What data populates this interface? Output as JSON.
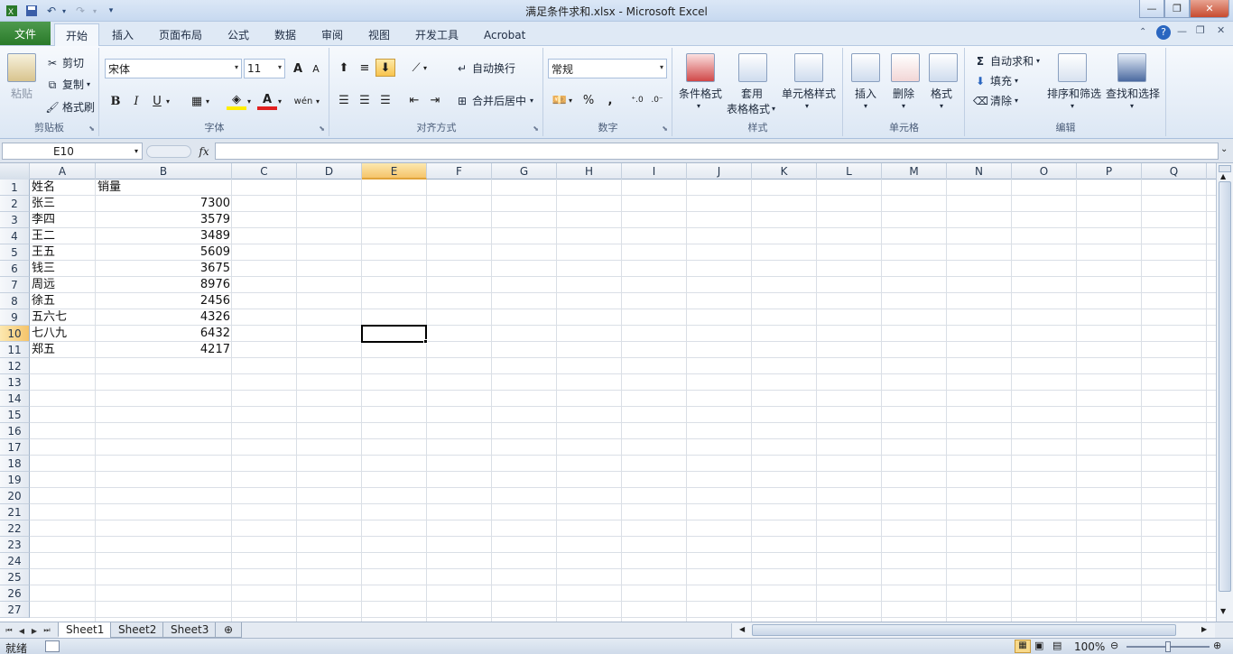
{
  "window": {
    "title": "满足条件求和.xlsx - Microsoft Excel"
  },
  "quick_access": [
    "save-icon",
    "undo-icon",
    "redo-icon",
    "customize-icon"
  ],
  "tabs": [
    {
      "label": "文件"
    },
    {
      "label": "开始"
    },
    {
      "label": "插入"
    },
    {
      "label": "页面布局"
    },
    {
      "label": "公式"
    },
    {
      "label": "数据"
    },
    {
      "label": "审阅"
    },
    {
      "label": "视图"
    },
    {
      "label": "开发工具"
    },
    {
      "label": "Acrobat"
    }
  ],
  "ribbon": {
    "clipboard": {
      "label": "剪贴板",
      "paste": "粘贴",
      "cut": "剪切",
      "copy": "复制",
      "format_painter": "格式刷"
    },
    "font": {
      "label": "字体",
      "font_name": "宋体",
      "font_size": "11",
      "bold": "B",
      "italic": "I",
      "underline": "U",
      "grow": "A",
      "shrink": "A",
      "font_color": "A",
      "phonetic": "wén"
    },
    "alignment": {
      "label": "对齐方式",
      "wrap_text": "自动换行",
      "merge_center": "合并后居中"
    },
    "number": {
      "label": "数字",
      "format": "常规",
      "percent": "%",
      "comma": ","
    },
    "styles": {
      "label": "样式",
      "conditional": "条件格式",
      "table_format_1": "套用",
      "table_format_2": "表格格式",
      "cell_styles": "单元格样式"
    },
    "cells": {
      "label": "单元格",
      "insert": "插入",
      "delete": "删除",
      "format": "格式"
    },
    "editing": {
      "label": "编辑",
      "autosum": "自动求和",
      "fill": "填充",
      "clear": "清除",
      "sort_filter": "排序和筛选",
      "find_select": "查找和选择"
    }
  },
  "formula_bar": {
    "name_box": "E10",
    "fx": "fx",
    "content": ""
  },
  "columns": [
    "A",
    "B",
    "C",
    "D",
    "E",
    "F",
    "G",
    "H",
    "I",
    "J",
    "K",
    "L",
    "M",
    "N",
    "O",
    "P",
    "Q"
  ],
  "rows": [
    "1",
    "2",
    "3",
    "4",
    "5",
    "6",
    "7",
    "8",
    "9",
    "10",
    "11",
    "12",
    "13",
    "14",
    "15",
    "16",
    "17",
    "18",
    "19",
    "20",
    "21",
    "22",
    "23",
    "24",
    "25",
    "26",
    "27"
  ],
  "sheet": {
    "header": {
      "a": "姓名",
      "b": "销量"
    },
    "data": [
      {
        "name": "张三",
        "sales": "7300"
      },
      {
        "name": "李四",
        "sales": "3579"
      },
      {
        "name": "王二",
        "sales": "3489"
      },
      {
        "name": "王五",
        "sales": "5609"
      },
      {
        "name": "钱三",
        "sales": "3675"
      },
      {
        "name": "周远",
        "sales": "8976"
      },
      {
        "name": "徐五",
        "sales": "2456"
      },
      {
        "name": "五六七",
        "sales": "4326"
      },
      {
        "name": "七八九",
        "sales": "6432"
      },
      {
        "name": "郑五",
        "sales": "4217"
      }
    ],
    "selected_cell": "E10"
  },
  "sheet_tabs": [
    "Sheet1",
    "Sheet2",
    "Sheet3"
  ],
  "status": {
    "ready": "就绪",
    "zoom": "100%"
  },
  "colors": {
    "file_tab": "#2a7a2a",
    "selection_header": "#f5c46a"
  }
}
